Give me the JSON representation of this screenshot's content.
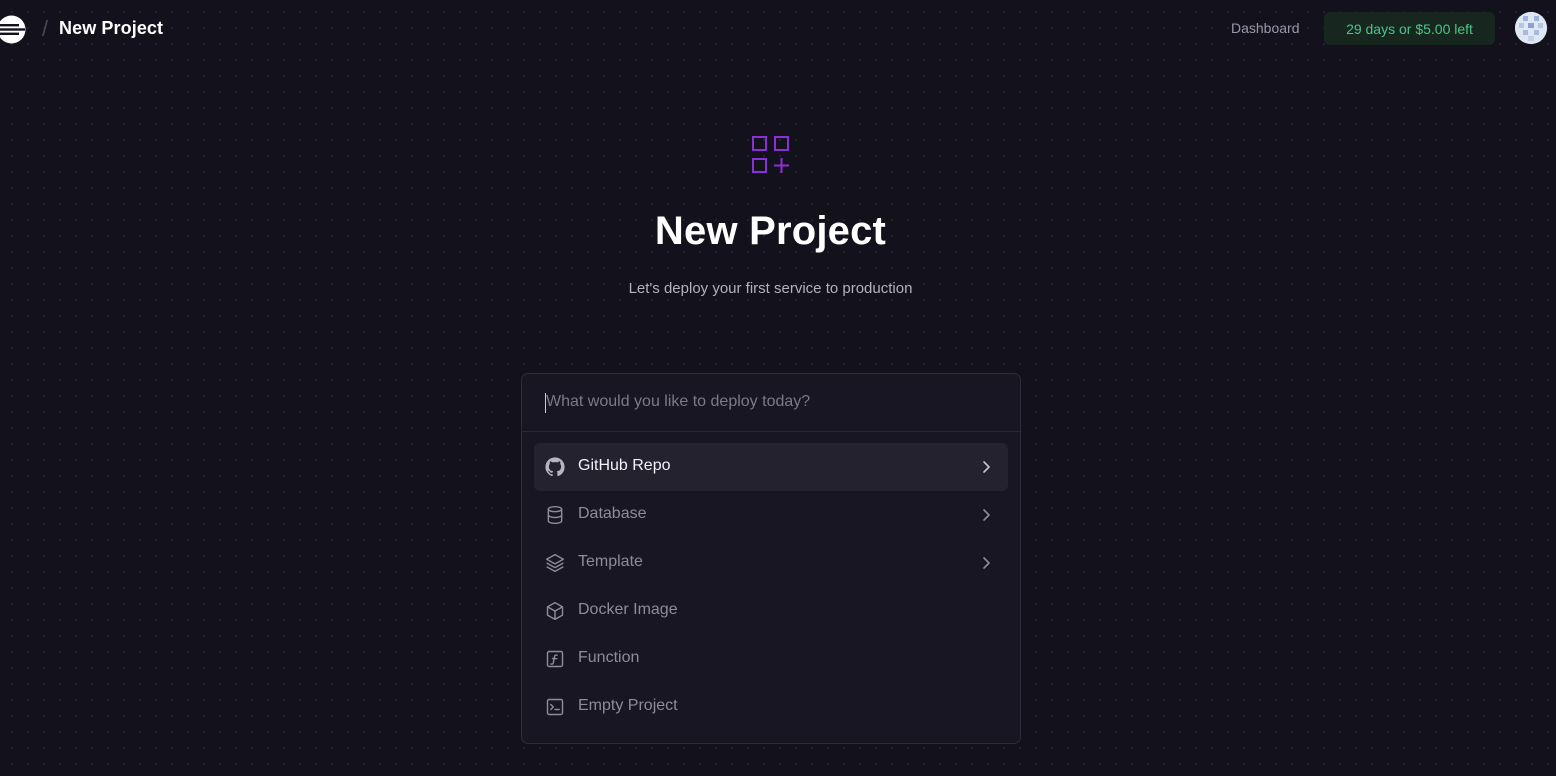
{
  "header": {
    "separator": "/",
    "title": "New Project",
    "dashboard_label": "Dashboard",
    "trial_badge": "29 days or $5.00 left"
  },
  "hero": {
    "title": "New Project",
    "subtitle": "Let's deploy your first service to production"
  },
  "search": {
    "placeholder": "What would you like to deploy today?"
  },
  "options": [
    {
      "label": "GitHub Repo",
      "icon": "github-icon",
      "has_submenu": true,
      "active": true
    },
    {
      "label": "Database",
      "icon": "database-icon",
      "has_submenu": true,
      "active": false
    },
    {
      "label": "Template",
      "icon": "layers-icon",
      "has_submenu": true,
      "active": false
    },
    {
      "label": "Docker Image",
      "icon": "box-icon",
      "has_submenu": false,
      "active": false
    },
    {
      "label": "Function",
      "icon": "function-icon",
      "has_submenu": false,
      "active": false
    },
    {
      "label": "Empty Project",
      "icon": "terminal-icon",
      "has_submenu": false,
      "active": false
    }
  ],
  "colors": {
    "background": "#13111c",
    "accent_purple": "#8b2fd6",
    "trial_green": "#49c48a"
  }
}
